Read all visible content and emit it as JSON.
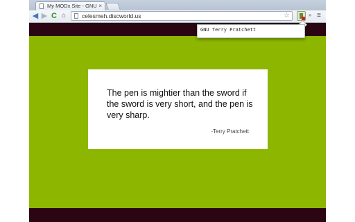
{
  "tab": {
    "title": "My MODx Site - GNU",
    "close_glyph": "×"
  },
  "toolbar": {
    "back_glyph": "◀",
    "forward_glyph": "▶",
    "reload_glyph": "C",
    "home_glyph": "⌂",
    "url": "celesmeh.discworld.us",
    "star_glyph": "☆",
    "chevrons_glyph": "»",
    "menu_glyph": "≡"
  },
  "page": {
    "quote": "The pen is mightier than the sword if the sword is very short, and the pen is very sharp.",
    "author": "-Terry Pratchett",
    "colors": {
      "background": "#8db600",
      "band": "#2b0612",
      "card": "#ffffff"
    }
  },
  "popup": {
    "text": "GNU Terry Pratchett"
  }
}
